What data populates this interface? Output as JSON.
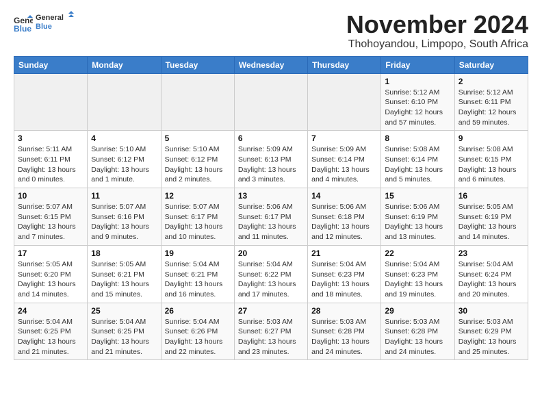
{
  "header": {
    "logo_line1": "General",
    "logo_line2": "Blue",
    "month_title": "November 2024",
    "location": "Thohoyandou, Limpopo, South Africa"
  },
  "days_of_week": [
    "Sunday",
    "Monday",
    "Tuesday",
    "Wednesday",
    "Thursday",
    "Friday",
    "Saturday"
  ],
  "weeks": [
    [
      {
        "day": "",
        "info": ""
      },
      {
        "day": "",
        "info": ""
      },
      {
        "day": "",
        "info": ""
      },
      {
        "day": "",
        "info": ""
      },
      {
        "day": "",
        "info": ""
      },
      {
        "day": "1",
        "info": "Sunrise: 5:12 AM\nSunset: 6:10 PM\nDaylight: 12 hours and 57 minutes."
      },
      {
        "day": "2",
        "info": "Sunrise: 5:12 AM\nSunset: 6:11 PM\nDaylight: 12 hours and 59 minutes."
      }
    ],
    [
      {
        "day": "3",
        "info": "Sunrise: 5:11 AM\nSunset: 6:11 PM\nDaylight: 13 hours and 0 minutes."
      },
      {
        "day": "4",
        "info": "Sunrise: 5:10 AM\nSunset: 6:12 PM\nDaylight: 13 hours and 1 minute."
      },
      {
        "day": "5",
        "info": "Sunrise: 5:10 AM\nSunset: 6:12 PM\nDaylight: 13 hours and 2 minutes."
      },
      {
        "day": "6",
        "info": "Sunrise: 5:09 AM\nSunset: 6:13 PM\nDaylight: 13 hours and 3 minutes."
      },
      {
        "day": "7",
        "info": "Sunrise: 5:09 AM\nSunset: 6:14 PM\nDaylight: 13 hours and 4 minutes."
      },
      {
        "day": "8",
        "info": "Sunrise: 5:08 AM\nSunset: 6:14 PM\nDaylight: 13 hours and 5 minutes."
      },
      {
        "day": "9",
        "info": "Sunrise: 5:08 AM\nSunset: 6:15 PM\nDaylight: 13 hours and 6 minutes."
      }
    ],
    [
      {
        "day": "10",
        "info": "Sunrise: 5:07 AM\nSunset: 6:15 PM\nDaylight: 13 hours and 7 minutes."
      },
      {
        "day": "11",
        "info": "Sunrise: 5:07 AM\nSunset: 6:16 PM\nDaylight: 13 hours and 9 minutes."
      },
      {
        "day": "12",
        "info": "Sunrise: 5:07 AM\nSunset: 6:17 PM\nDaylight: 13 hours and 10 minutes."
      },
      {
        "day": "13",
        "info": "Sunrise: 5:06 AM\nSunset: 6:17 PM\nDaylight: 13 hours and 11 minutes."
      },
      {
        "day": "14",
        "info": "Sunrise: 5:06 AM\nSunset: 6:18 PM\nDaylight: 13 hours and 12 minutes."
      },
      {
        "day": "15",
        "info": "Sunrise: 5:06 AM\nSunset: 6:19 PM\nDaylight: 13 hours and 13 minutes."
      },
      {
        "day": "16",
        "info": "Sunrise: 5:05 AM\nSunset: 6:19 PM\nDaylight: 13 hours and 14 minutes."
      }
    ],
    [
      {
        "day": "17",
        "info": "Sunrise: 5:05 AM\nSunset: 6:20 PM\nDaylight: 13 hours and 14 minutes."
      },
      {
        "day": "18",
        "info": "Sunrise: 5:05 AM\nSunset: 6:21 PM\nDaylight: 13 hours and 15 minutes."
      },
      {
        "day": "19",
        "info": "Sunrise: 5:04 AM\nSunset: 6:21 PM\nDaylight: 13 hours and 16 minutes."
      },
      {
        "day": "20",
        "info": "Sunrise: 5:04 AM\nSunset: 6:22 PM\nDaylight: 13 hours and 17 minutes."
      },
      {
        "day": "21",
        "info": "Sunrise: 5:04 AM\nSunset: 6:23 PM\nDaylight: 13 hours and 18 minutes."
      },
      {
        "day": "22",
        "info": "Sunrise: 5:04 AM\nSunset: 6:23 PM\nDaylight: 13 hours and 19 minutes."
      },
      {
        "day": "23",
        "info": "Sunrise: 5:04 AM\nSunset: 6:24 PM\nDaylight: 13 hours and 20 minutes."
      }
    ],
    [
      {
        "day": "24",
        "info": "Sunrise: 5:04 AM\nSunset: 6:25 PM\nDaylight: 13 hours and 21 minutes."
      },
      {
        "day": "25",
        "info": "Sunrise: 5:04 AM\nSunset: 6:25 PM\nDaylight: 13 hours and 21 minutes."
      },
      {
        "day": "26",
        "info": "Sunrise: 5:04 AM\nSunset: 6:26 PM\nDaylight: 13 hours and 22 minutes."
      },
      {
        "day": "27",
        "info": "Sunrise: 5:03 AM\nSunset: 6:27 PM\nDaylight: 13 hours and 23 minutes."
      },
      {
        "day": "28",
        "info": "Sunrise: 5:03 AM\nSunset: 6:28 PM\nDaylight: 13 hours and 24 minutes."
      },
      {
        "day": "29",
        "info": "Sunrise: 5:03 AM\nSunset: 6:28 PM\nDaylight: 13 hours and 24 minutes."
      },
      {
        "day": "30",
        "info": "Sunrise: 5:03 AM\nSunset: 6:29 PM\nDaylight: 13 hours and 25 minutes."
      }
    ]
  ]
}
